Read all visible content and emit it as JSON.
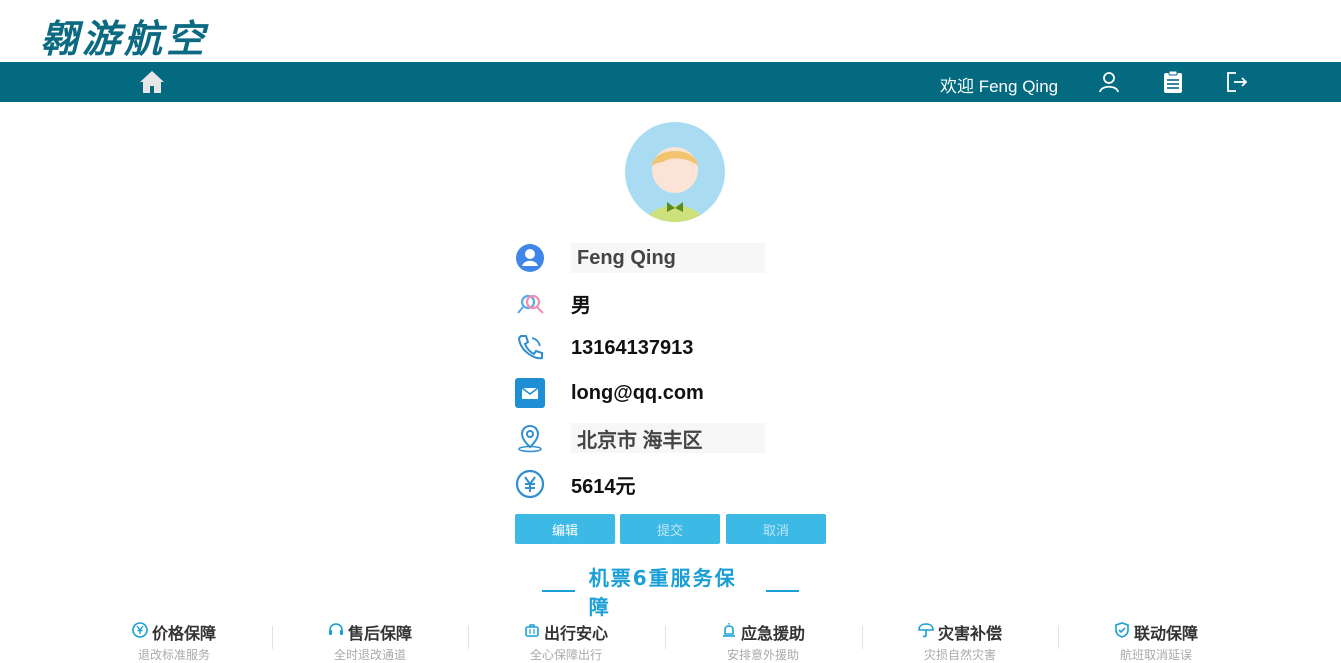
{
  "brand": {
    "logo_text": "翱游航空"
  },
  "header": {
    "welcome": "欢迎 Feng Qing"
  },
  "profile": {
    "name": "Feng Qing",
    "gender": "男",
    "phone": "13164137913",
    "email": "long@qq.com",
    "address": "北京市 海丰区",
    "balance": "5614元"
  },
  "actions": {
    "edit": "编辑",
    "submit": "提交",
    "cancel": "取消"
  },
  "services": {
    "title": "机票6重服务保障",
    "items": [
      {
        "title": "价格保障",
        "sub": "退改标准服务"
      },
      {
        "title": "售后保障",
        "sub": "全时退改通道"
      },
      {
        "title": "出行安心",
        "sub": "全心保障出行"
      },
      {
        "title": "应急援助",
        "sub": "安排意外援助"
      },
      {
        "title": "灾害补偿",
        "sub": "灾损自然灾害"
      },
      {
        "title": "联动保障",
        "sub": "航班取消延误"
      }
    ]
  },
  "colors": {
    "navbar": "#036a80",
    "accent": "#3db9e6",
    "title": "#1a9fd6"
  }
}
